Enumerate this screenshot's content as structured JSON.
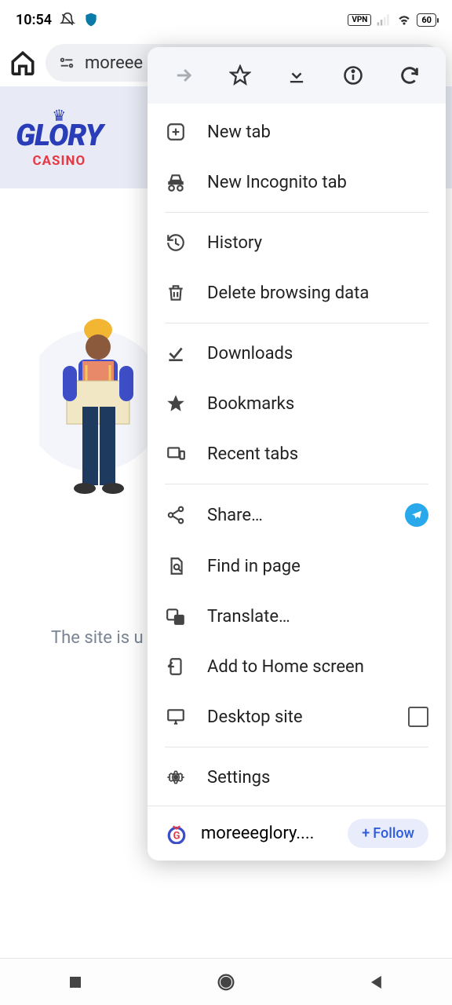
{
  "status": {
    "time": "10:54",
    "vpn": "VPN",
    "battery": "60"
  },
  "url_bar": {
    "text": "moreee"
  },
  "page": {
    "logo_top": "GLORY",
    "logo_bottom": "CASINO",
    "message": "The site is u"
  },
  "menu": {
    "items": {
      "new_tab": "New tab",
      "incognito": "New Incognito tab",
      "history": "History",
      "delete_data": "Delete browsing data",
      "downloads": "Downloads",
      "bookmarks": "Bookmarks",
      "recent_tabs": "Recent tabs",
      "share": "Share…",
      "find": "Find in page",
      "translate": "Translate…",
      "add_home": "Add to Home screen",
      "desktop": "Desktop site",
      "settings": "Settings"
    },
    "follow": {
      "site": "moreeeglory....",
      "button": "Follow"
    }
  }
}
